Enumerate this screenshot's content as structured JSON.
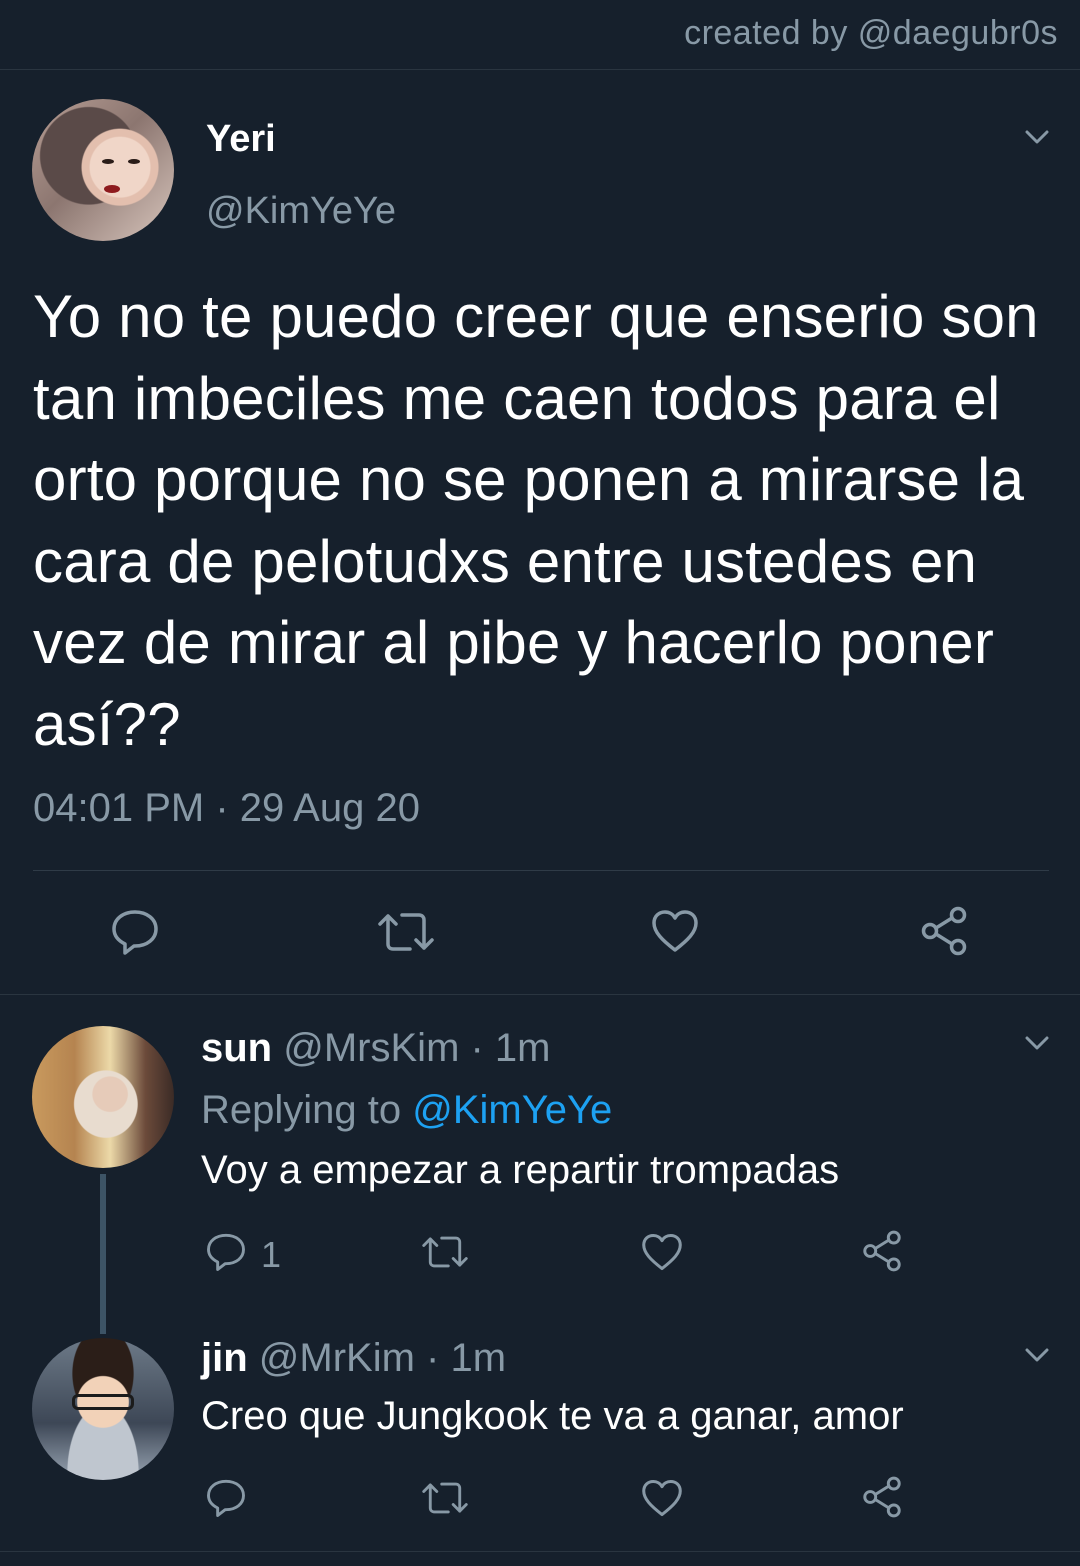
{
  "credit": "created by @daegubr0s",
  "main_tweet": {
    "name": "Yeri",
    "handle": "@KimYeYe",
    "text": "Yo no te puedo creer que enserio son tan imbeciles me caen todos para el orto porque no se ponen a mirarse la cara de pelotudxs entre ustedes en vez de mirar al pibe y hacerlo poner así??",
    "timestamp": "04:01 PM · 29 Aug 20",
    "icons": {
      "reply": "reply-icon",
      "retweet": "retweet-icon",
      "like": "like-icon",
      "share": "share-icon",
      "menu": "chevron-down-icon"
    }
  },
  "replies": [
    {
      "name": "sun",
      "meta": "@MrsKim · 1m",
      "replying_prefix": "Replying to ",
      "replying_to": "@KimYeYe",
      "text": "Voy a empezar a repartir trompadas",
      "reply_count": "1"
    },
    {
      "name": "jin",
      "meta": "@MrKim · 1m",
      "text": "Creo que Jungkook te va a ganar, amor",
      "reply_count": ""
    }
  ],
  "colors": {
    "background": "#16202c",
    "secondary_text": "#8899a6",
    "link": "#1da1f2",
    "divider": "#2a3540"
  }
}
